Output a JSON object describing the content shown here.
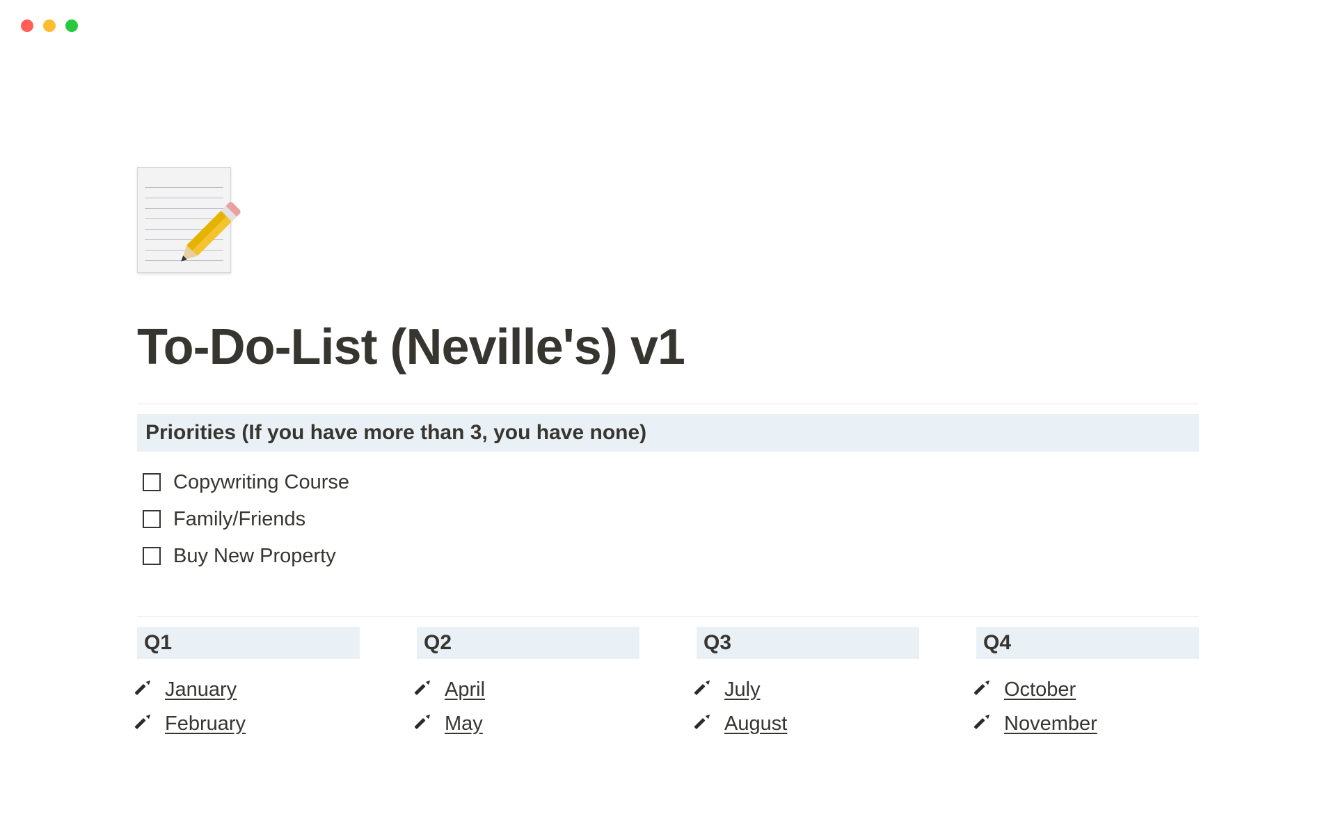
{
  "page": {
    "title": "To-Do-List (Neville's) v1"
  },
  "priorities": {
    "heading": "Priorities (If you have more than 3, you have none)",
    "items": [
      {
        "label": "Copywriting Course"
      },
      {
        "label": "Family/Friends"
      },
      {
        "label": "Buy New Property"
      }
    ]
  },
  "quarters": [
    {
      "label": "Q1",
      "months": [
        "January",
        "February"
      ]
    },
    {
      "label": "Q2",
      "months": [
        "April",
        "May"
      ]
    },
    {
      "label": "Q3",
      "months": [
        "July",
        "August"
      ]
    },
    {
      "label": "Q4",
      "months": [
        "October",
        "November"
      ]
    }
  ]
}
